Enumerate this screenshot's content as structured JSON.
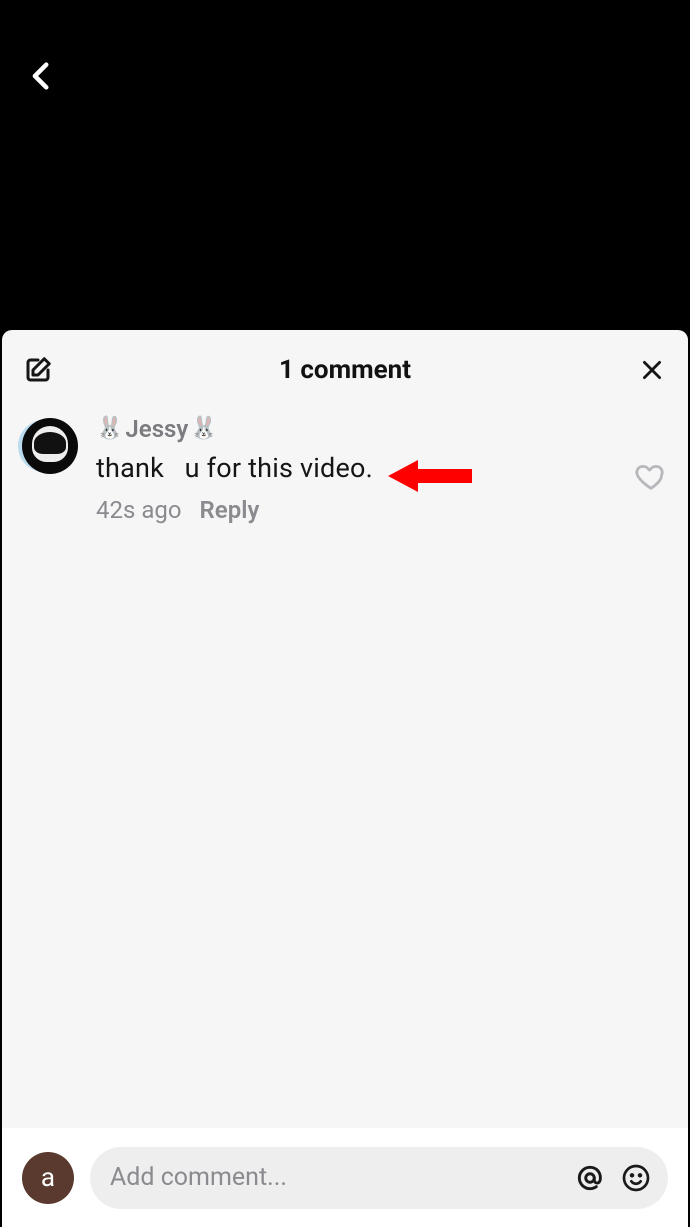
{
  "nav": {
    "back_icon": "chevron-left"
  },
  "sheet": {
    "compose_icon": "compose",
    "title": "1 comment",
    "close_icon": "close"
  },
  "comments": [
    {
      "name_prefix_icon": "🐰",
      "name": "Jessy",
      "name_suffix_icon": "🐰",
      "text": "thank   u for this video.",
      "timestamp": "42s ago",
      "reply_label": "Reply",
      "like_icon": "heart"
    }
  ],
  "annotation": {
    "arrow_color": "#ff0000"
  },
  "input": {
    "self_avatar_initial": "a",
    "placeholder": "Add comment...",
    "mention_icon": "at",
    "emoji_icon": "smiley"
  }
}
